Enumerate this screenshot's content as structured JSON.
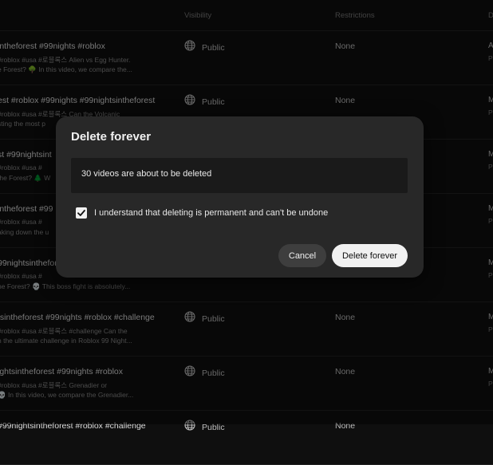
{
  "table": {
    "headers": {
      "visibility": "Visibility",
      "restrictions": "Restrictions",
      "date": "D"
    },
    "rows": [
      {
        "title": "intheforest #99nights #roblox",
        "desc1": "#roblox #usa #로블록스 Alien vs Egg Hunter.",
        "desc2": "e Forest? 🌳 In this video, we compare the...",
        "visibility": "Public",
        "restrictions": "None",
        "date": "A",
        "date_sub": "P"
      },
      {
        "title": "est #roblox #99nights #99nightsintheforest",
        "desc1": "#roblox #usa #로블록스 Can the Volcanic",
        "desc2": "sting the most p",
        "visibility": "Public",
        "restrictions": "None",
        "date": "M",
        "date_sub": "P"
      },
      {
        "title": "st #99nightsint",
        "desc1": "#roblox #usa #",
        "desc2": "the Forest? 🌲 W",
        "visibility": "",
        "restrictions": "",
        "date": "M",
        "date_sub": "P"
      },
      {
        "title": "intheforest #99",
        "desc1": "#roblox #usa #",
        "desc2": "aking down the u",
        "visibility": "",
        "restrictions": "",
        "date": "M",
        "date_sub": "P"
      },
      {
        "title": "99nightsinthefor",
        "desc1": "#roblox #usa #",
        "desc2": "he Forest? 💀 This boss fight is absolutely...",
        "visibility": "",
        "restrictions": "",
        "date": "M",
        "date_sub": "P"
      },
      {
        "title": "tsintheforest #99nights #roblox #challenge",
        "desc1": "#roblox #usa #로블록스 #challenge Can the",
        "desc2": "n the ultimate challenge in Roblox 99 Night...",
        "visibility": "Public",
        "restrictions": "None",
        "date": "M",
        "date_sub": "P"
      },
      {
        "title": "ightsintheforest #99nights #roblox",
        "desc1": "#roblox #usa #로블록스 Grenadier or",
        "desc2": "💀 In this video, we compare the Grenadier...",
        "visibility": "Public",
        "restrictions": "None",
        "date": "M",
        "date_sub": "P"
      },
      {
        "title": "#99nightsintheforest #roblox #challenge",
        "desc1": "",
        "desc2": "",
        "visibility": "Public",
        "restrictions": "None",
        "date": "",
        "date_sub": ""
      }
    ]
  },
  "dialog": {
    "title": "Delete forever",
    "message": "30 videos are about to be deleted",
    "checkbox_label": "I understand that deleting is permanent and can't be undone",
    "checkbox_checked": true,
    "cancel_label": "Cancel",
    "delete_label": "Delete forever"
  },
  "icons": {
    "visibility": "globe-icon",
    "checkbox": "check-icon"
  },
  "colors": {
    "background": "#0f0f0f",
    "dialog": "#282828",
    "primary_button": "#f1f1f1",
    "secondary_button": "#3e3e3e"
  }
}
